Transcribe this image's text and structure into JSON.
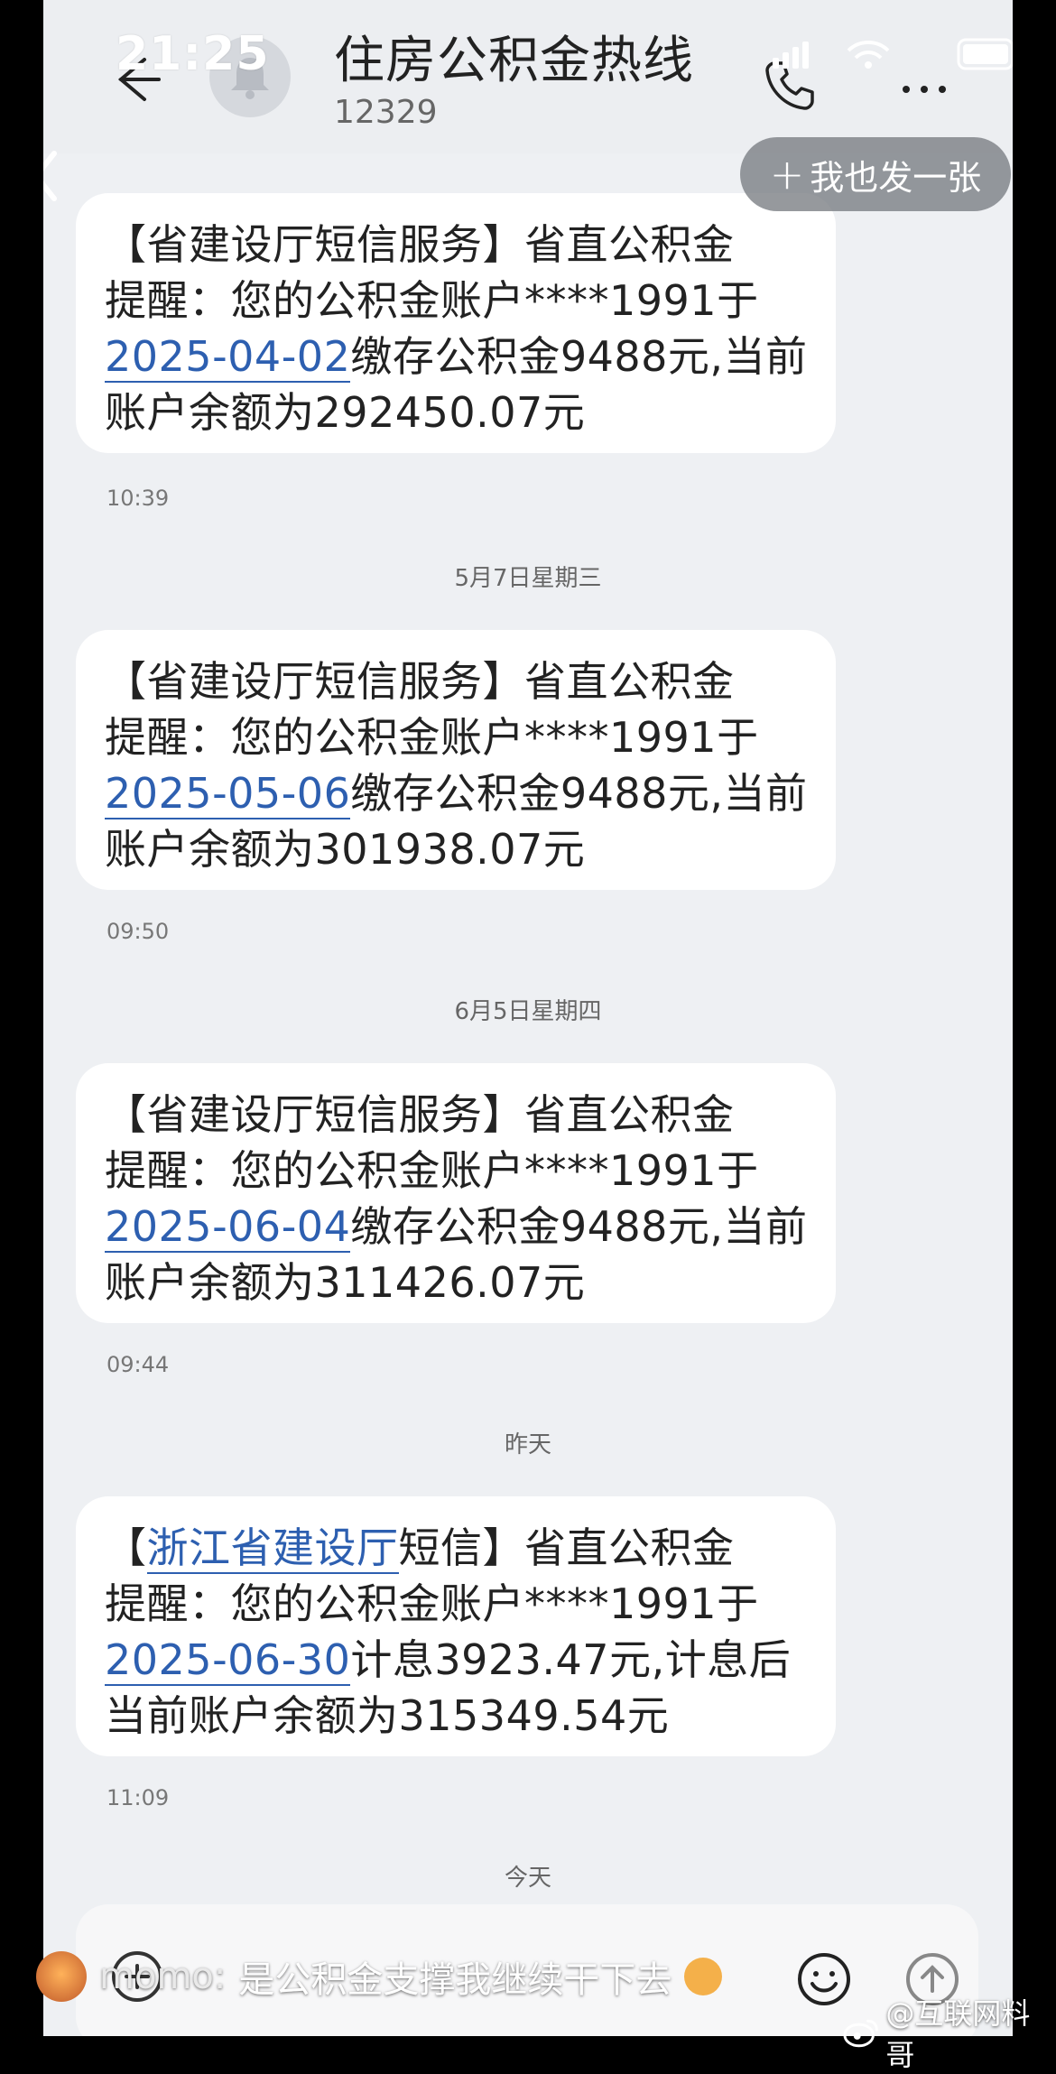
{
  "status_bar": {
    "time": "21:25"
  },
  "header": {
    "title": "住房公积金热线",
    "number": "12329"
  },
  "post_button": {
    "label": "我也发一张"
  },
  "messages": [
    {
      "lines": [
        "【省建设厅短信服务】省直公积金",
        "提醒：您的公积金账户****1991于"
      ],
      "link": "2025-04-02",
      "rest": "缴存公积金9488元,当前",
      "last": "账户余额为292450.07元",
      "time": "10:39"
    },
    {
      "divider": "5月7日星期三",
      "lines": [
        "【省建设厅短信服务】省直公积金",
        "提醒：您的公积金账户****1991于"
      ],
      "link": "2025-05-06",
      "rest": "缴存公积金9488元,当前",
      "last": "账户余额为301938.07元",
      "time": "09:50"
    },
    {
      "divider": "6月5日星期四",
      "lines": [
        "【省建设厅短信服务】省直公积金",
        "提醒：您的公积金账户****1991于"
      ],
      "link": "2025-06-04",
      "rest": "缴存公积金9488元,当前",
      "last": "账户余额为311426.07元",
      "time": "09:44"
    },
    {
      "divider": "昨天",
      "prefix": "【",
      "prefix_link": "浙江省建设厅",
      "prefix_rest": "短信】省直公积金",
      "line2": "提醒：您的公积金账户****1991于",
      "link": "2025-06-30",
      "rest": "计息3923.47元,计息后",
      "last": "当前账户余额为315349.54元",
      "time": "11:09"
    }
  ],
  "today_divider": "今天",
  "comment": {
    "user": "momo:",
    "text": "是公积金支撑我继续干下去"
  },
  "watermark": "@互联网料哥",
  "icons": [
    "back-arrow-icon",
    "bell-avatar-icon",
    "phone-call-icon",
    "more-icon",
    "signal-icon",
    "wifi-icon",
    "battery-icon",
    "plus-icon",
    "smile-icon",
    "send-icon",
    "weibo-icon"
  ]
}
